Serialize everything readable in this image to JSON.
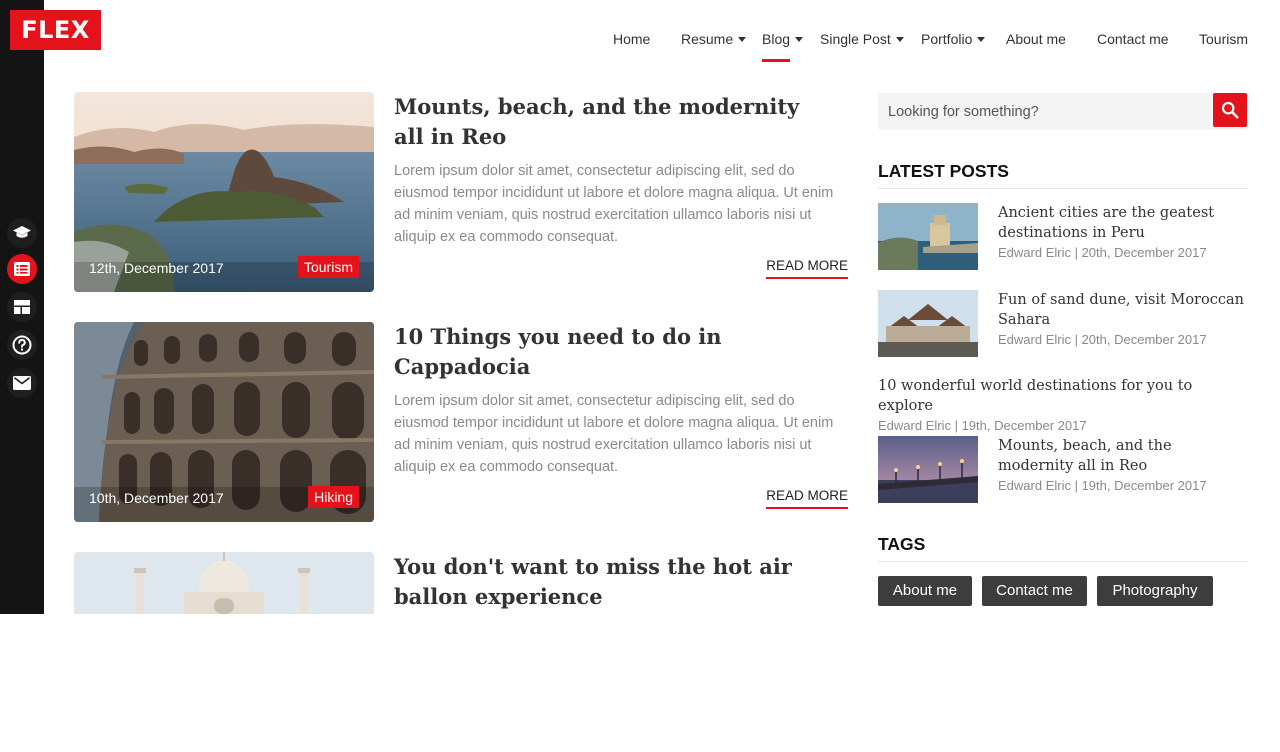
{
  "brand": {
    "logo": "FLEX",
    "accent": "#e4121a",
    "sidebar_bg": "#141414"
  },
  "nav": {
    "items": [
      {
        "label": "Home",
        "has_dropdown": false
      },
      {
        "label": "Resume",
        "has_dropdown": true
      },
      {
        "label": "Blog",
        "has_dropdown": true,
        "active": true
      },
      {
        "label": "Single Post",
        "has_dropdown": true
      },
      {
        "label": "Portfolio",
        "has_dropdown": true
      },
      {
        "label": "About me",
        "has_dropdown": false
      },
      {
        "label": "Contact me",
        "has_dropdown": false
      },
      {
        "label": "Tourism",
        "has_dropdown": false
      }
    ]
  },
  "sidebar_icons": [
    {
      "name": "graduation-cap-icon",
      "active": false
    },
    {
      "name": "blog-list-icon",
      "active": true
    },
    {
      "name": "portfolio-grid-icon",
      "active": false
    },
    {
      "name": "help-circle-icon",
      "active": false
    },
    {
      "name": "mail-icon",
      "active": false
    }
  ],
  "posts": [
    {
      "title": "Mounts, beach, and the modernity all in Reo",
      "excerpt": "Lorem ipsum dolor sit amet, consectetur adipiscing elit, sed do eiusmod tempor incididunt ut labore et dolore magna aliqua. Ut enim ad minim veniam, quis nostrud exercitation ullamco laboris nisi ut aliquip ex ea commodo consequat.",
      "date": "12th, December 2017",
      "category": "Tourism",
      "read_more": "READ MORE"
    },
    {
      "title": "10 Things you need to do in Cappadocia",
      "excerpt": "Lorem ipsum dolor sit amet, consectetur adipiscing elit, sed do eiusmod tempor incididunt ut labore et dolore magna aliqua. Ut enim ad minim veniam, quis nostrud exercitation ullamco laboris nisi ut aliquip ex ea commodo consequat.",
      "date": "10th, December 2017",
      "category": "Hiking",
      "read_more": "READ MORE"
    },
    {
      "title": "You don't want to miss the hot air ballon experience"
    }
  ],
  "search": {
    "placeholder": "Looking for something?"
  },
  "latest_posts": {
    "heading": "LATEST POSTS",
    "items": [
      {
        "title": "Ancient cities are the geatest destinations in Peru",
        "meta": "Edward Elric | 20th, December 2017"
      },
      {
        "title": "Fun of sand dune, visit Moroccan Sahara",
        "meta": "Edward Elric | 20th, December 2017"
      },
      {
        "title": "10 wonderful world destinations for you to explore",
        "meta": "Edward Elric | 19th, December 2017"
      },
      {
        "title": "Mounts, beach, and the modernity all in Reo",
        "meta": "Edward Elric | 19th, December 2017"
      }
    ]
  },
  "tags": {
    "heading": "TAGS",
    "items": [
      "About me",
      "Contact me",
      "Photography"
    ]
  }
}
